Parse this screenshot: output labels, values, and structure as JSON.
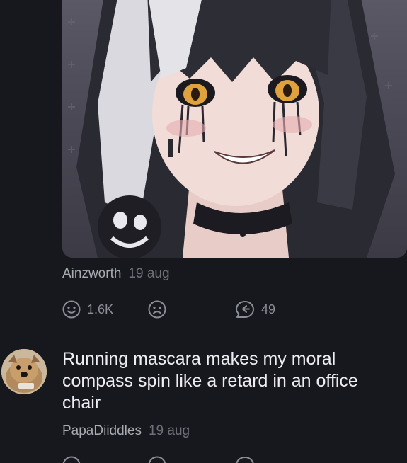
{
  "posts": [
    {
      "author": "Ainzworth",
      "date": "19 aug",
      "likes": "1.6K",
      "replies": "49",
      "image_icon": "anime-girl-image"
    },
    {
      "text": "Running mascara makes my moral compass spin like a retard in an office chair",
      "author": "PapaDiiddles",
      "date": "19 aug",
      "avatar_icon": "dog-avatar"
    }
  ],
  "icons": {
    "like": "smile-icon",
    "dislike": "frown-icon",
    "reply": "reply-icon"
  },
  "colors": {
    "background": "#17181d",
    "author": "#a9abb3",
    "date": "#6f717a",
    "icon": "#8c8f98"
  }
}
